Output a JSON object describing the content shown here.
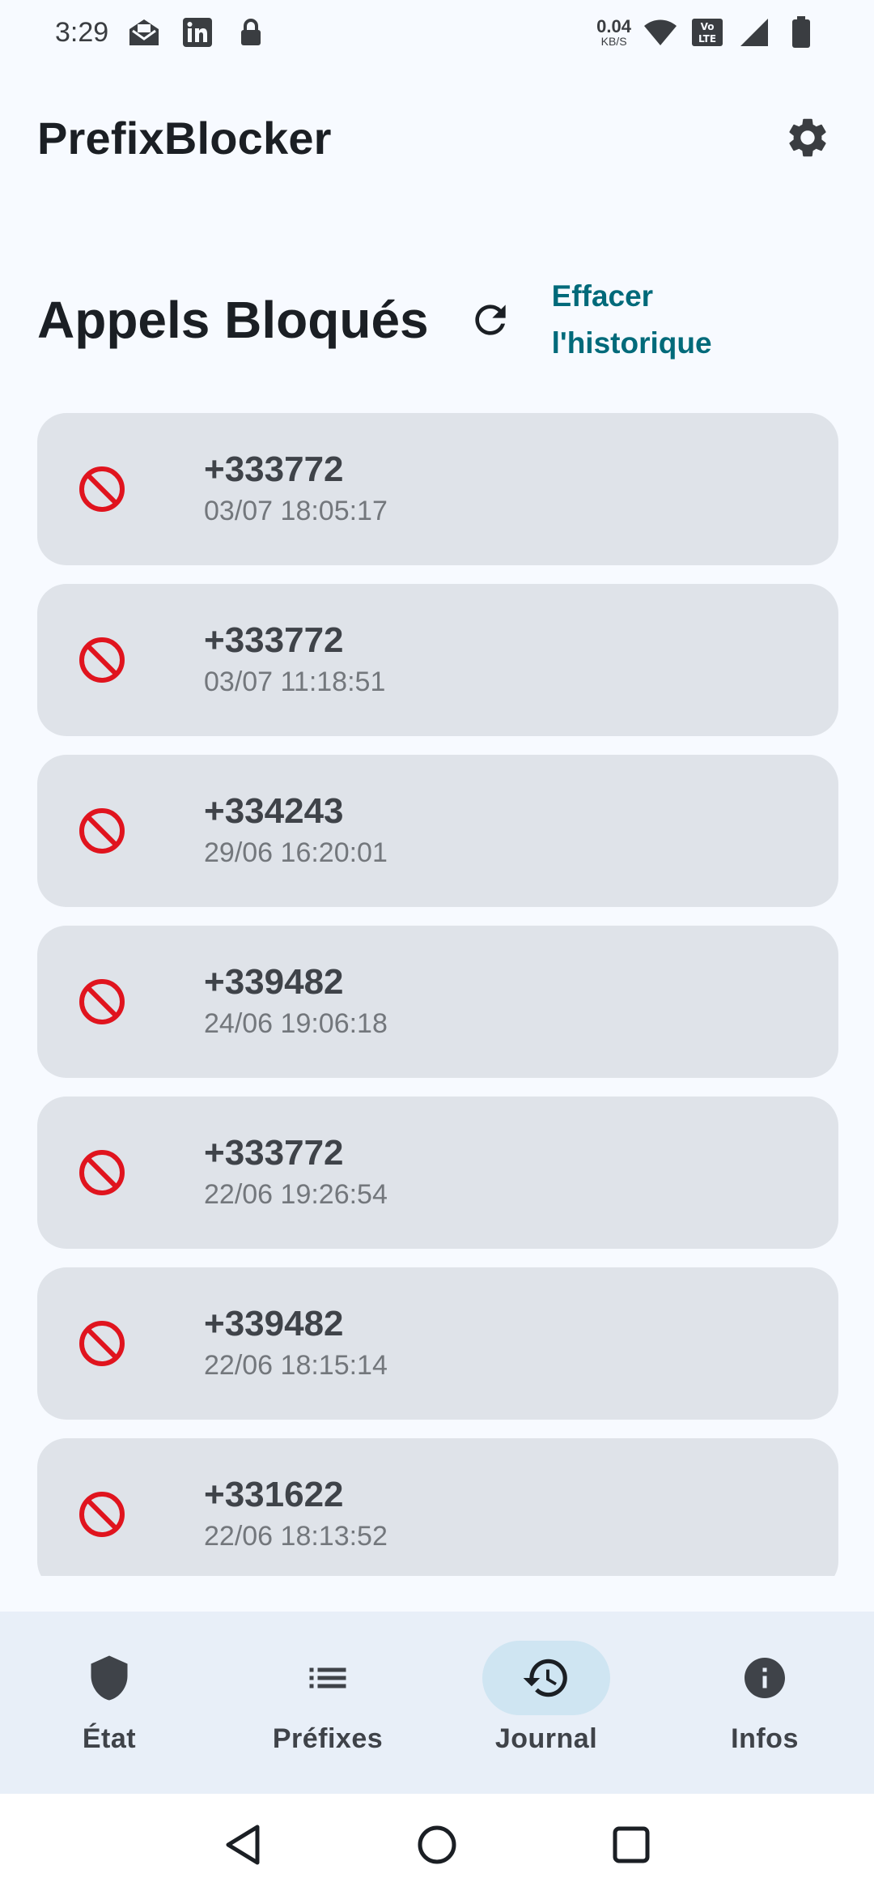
{
  "status_bar": {
    "time": "3:29",
    "net_speed": "0.04",
    "net_unit": "KB/S",
    "icons_left": [
      "mail-icon",
      "linkedin-icon",
      "lock-icon"
    ],
    "icons_right": [
      "wifi-icon",
      "volte-icon",
      "signal-icon",
      "battery-icon"
    ]
  },
  "app_bar": {
    "title": "PrefixBlocker",
    "settings_icon": "gear-icon"
  },
  "section": {
    "title": "Appels Bloqués",
    "clear_history_line1": "Effacer",
    "clear_history_line2": "l'historique"
  },
  "calls": [
    {
      "number": "+333772",
      "time": "03/07 18:05:17"
    },
    {
      "number": "+333772",
      "time": "03/07 11:18:51"
    },
    {
      "number": "+334243",
      "time": "29/06 16:20:01"
    },
    {
      "number": "+339482",
      "time": "24/06 19:06:18"
    },
    {
      "number": "+333772",
      "time": "22/06 19:26:54"
    },
    {
      "number": "+339482",
      "time": "22/06 18:15:14"
    },
    {
      "number": "+331622",
      "time": "22/06 18:13:52"
    }
  ],
  "bottom_nav": {
    "items": [
      {
        "label": "État",
        "icon": "shield-icon"
      },
      {
        "label": "Préfixes",
        "icon": "list-icon"
      },
      {
        "label": "Journal",
        "icon": "history-icon"
      },
      {
        "label": "Infos",
        "icon": "info-icon"
      }
    ],
    "active": "Journal"
  },
  "colors": {
    "background": "#f7faff",
    "card": "#dfe3e9",
    "accent": "#006a7a",
    "block_red": "#e0141e",
    "nav_bg": "#e8eff8",
    "nav_active_pill": "#cfe5f2"
  }
}
